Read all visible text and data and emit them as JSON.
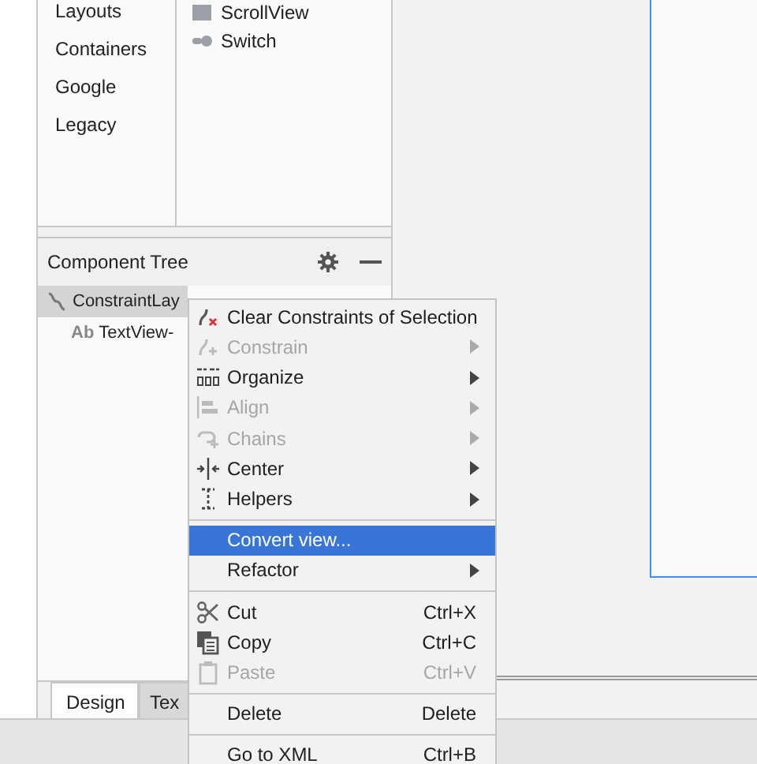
{
  "palette": {
    "categories": [
      {
        "label": "Layouts",
        "selected": false
      },
      {
        "label": "Containers",
        "selected": false
      },
      {
        "label": "Google",
        "selected": false
      },
      {
        "label": "Legacy",
        "selected": false
      }
    ],
    "widgets": [
      {
        "label": "ScrollView"
      },
      {
        "label": "Switch"
      }
    ]
  },
  "component_tree": {
    "title": "Component Tree",
    "nodes": [
      {
        "label": "ConstraintLay",
        "selected": true,
        "children": [
          {
            "badge": "Ab",
            "label": "TextView-",
            "selected": false
          }
        ]
      }
    ]
  },
  "bottom_tabs": [
    {
      "label": "Design",
      "selected": true
    },
    {
      "label": "Tex",
      "selected": false
    }
  ],
  "context_menu": [
    {
      "kind": "item",
      "label": "Clear Constraints of Selection",
      "disabled": false,
      "submenu": false,
      "selected": false
    },
    {
      "kind": "item",
      "label": "Constrain",
      "disabled": true,
      "submenu": true,
      "selected": false
    },
    {
      "kind": "item",
      "label": "Organize",
      "disabled": false,
      "submenu": true,
      "selected": false
    },
    {
      "kind": "item",
      "label": "Align",
      "disabled": true,
      "submenu": true,
      "selected": false
    },
    {
      "kind": "item",
      "label": "Chains",
      "disabled": true,
      "submenu": true,
      "selected": false
    },
    {
      "kind": "item",
      "label": "Center",
      "disabled": false,
      "submenu": true,
      "selected": false
    },
    {
      "kind": "item",
      "label": "Helpers",
      "disabled": false,
      "submenu": true,
      "selected": false
    },
    {
      "kind": "separator"
    },
    {
      "kind": "item",
      "label": "Convert view...",
      "disabled": false,
      "submenu": false,
      "selected": true
    },
    {
      "kind": "item",
      "label": "Refactor",
      "disabled": false,
      "submenu": true,
      "selected": false
    },
    {
      "kind": "separator"
    },
    {
      "kind": "item",
      "label": "Cut",
      "shortcut": "Ctrl+X",
      "disabled": false,
      "submenu": false,
      "selected": false
    },
    {
      "kind": "item",
      "label": "Copy",
      "shortcut": "Ctrl+C",
      "disabled": false,
      "submenu": false,
      "selected": false
    },
    {
      "kind": "item",
      "label": "Paste",
      "shortcut": "Ctrl+V",
      "disabled": true,
      "submenu": false,
      "selected": false
    },
    {
      "kind": "separator"
    },
    {
      "kind": "item",
      "label": "Delete",
      "shortcut": "Delete",
      "disabled": false,
      "submenu": false,
      "selected": false
    },
    {
      "kind": "separator"
    },
    {
      "kind": "item",
      "label": "Go to XML",
      "shortcut": "Ctrl+B",
      "disabled": false,
      "submenu": false,
      "selected": false
    }
  ]
}
